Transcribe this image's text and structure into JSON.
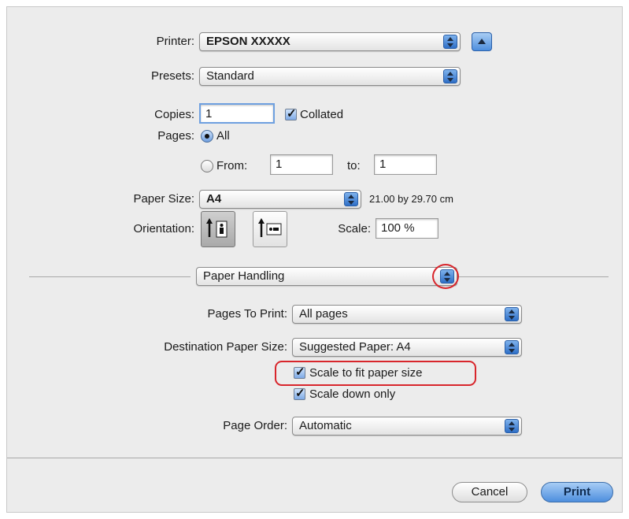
{
  "printer": {
    "label": "Printer:",
    "value": "EPSON XXXXX"
  },
  "presets": {
    "label": "Presets:",
    "value": "Standard"
  },
  "copies": {
    "label": "Copies:",
    "value": "1",
    "collated_label": "Collated",
    "collated_checked": true
  },
  "pages": {
    "label": "Pages:",
    "all_label": "All",
    "from_label": "From:",
    "from_value": "1",
    "to_label": "to:",
    "to_value": "1",
    "selected": "All"
  },
  "paper_size": {
    "label": "Paper Size:",
    "value": "A4",
    "dimensions": "21.00 by 29.70 cm"
  },
  "orientation": {
    "label": "Orientation:",
    "selected": "portrait"
  },
  "scale": {
    "label": "Scale:",
    "value": "100 %"
  },
  "panel_menu": {
    "value": "Paper Handling"
  },
  "pages_to_print": {
    "label": "Pages To Print:",
    "value": "All pages"
  },
  "destination_paper_size": {
    "label": "Destination Paper Size:",
    "value": "Suggested Paper: A4",
    "scale_to_fit_label": "Scale to fit paper size",
    "scale_to_fit_checked": true,
    "scale_down_label": "Scale down only",
    "scale_down_checked": true
  },
  "page_order": {
    "label": "Page Order:",
    "value": "Automatic"
  },
  "buttons": {
    "cancel": "Cancel",
    "print": "Print"
  },
  "icons": {
    "popup_arrows": "up-down-arrows-icon",
    "disclosure": "triangle-up-icon",
    "portrait": "portrait-orientation-icon",
    "landscape": "landscape-orientation-icon"
  },
  "colors": {
    "annotation": "#d8262c",
    "accent": "#4d8ede"
  }
}
